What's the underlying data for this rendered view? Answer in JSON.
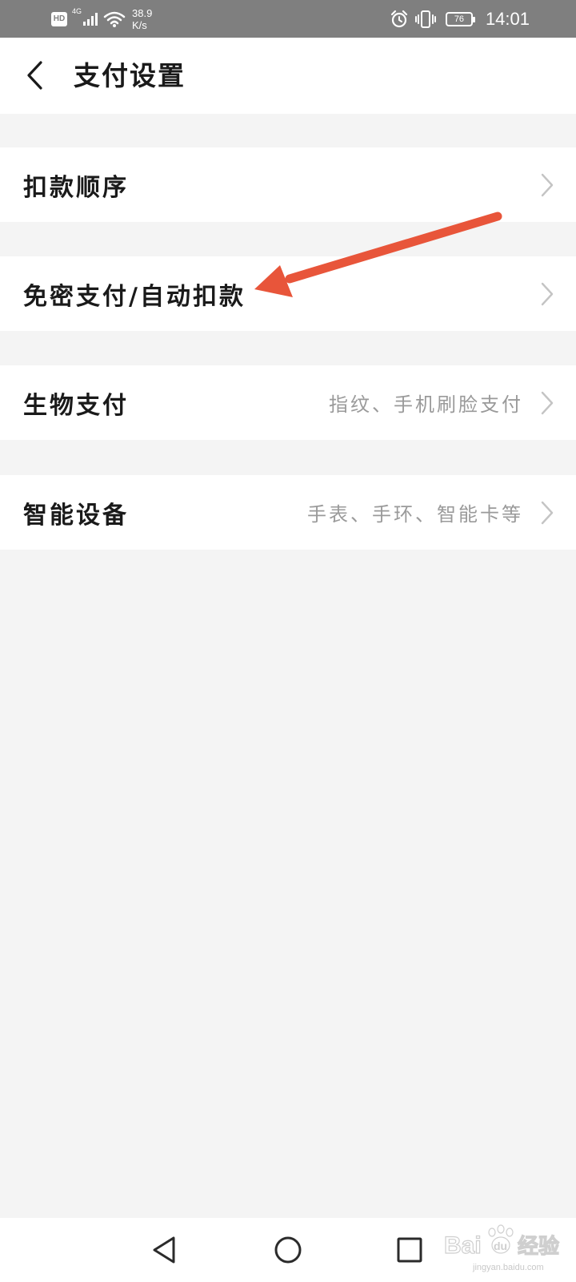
{
  "status_bar": {
    "hd": "HD",
    "network": "4G",
    "speed_value": "38.9",
    "speed_unit": "K/s",
    "battery": "76",
    "time": "14:01"
  },
  "header": {
    "back_icon": "chevron-left-icon",
    "title": "支付设置"
  },
  "menu": {
    "items": [
      {
        "label": "扣款顺序",
        "desc": ""
      },
      {
        "label": "免密支付/自动扣款",
        "desc": ""
      },
      {
        "label": "生物支付",
        "desc": "指纹、手机刷脸支付"
      },
      {
        "label": "智能设备",
        "desc": "手表、手环、智能卡等"
      }
    ]
  },
  "annotation": {
    "color": "#e8553a"
  },
  "nav_bar": {
    "back_icon": "triangle-back-icon",
    "home_icon": "circle-home-icon",
    "recents_icon": "square-recents-icon"
  },
  "watermark": {
    "url": "jingyan.baidu.com"
  },
  "colors": {
    "status_bar": "#7f7f7f",
    "background": "#f4f4f4",
    "card": "#ffffff",
    "label": "#1a1a1a",
    "secondary": "#9a9a9a",
    "chevron": "#c4c4c4"
  }
}
